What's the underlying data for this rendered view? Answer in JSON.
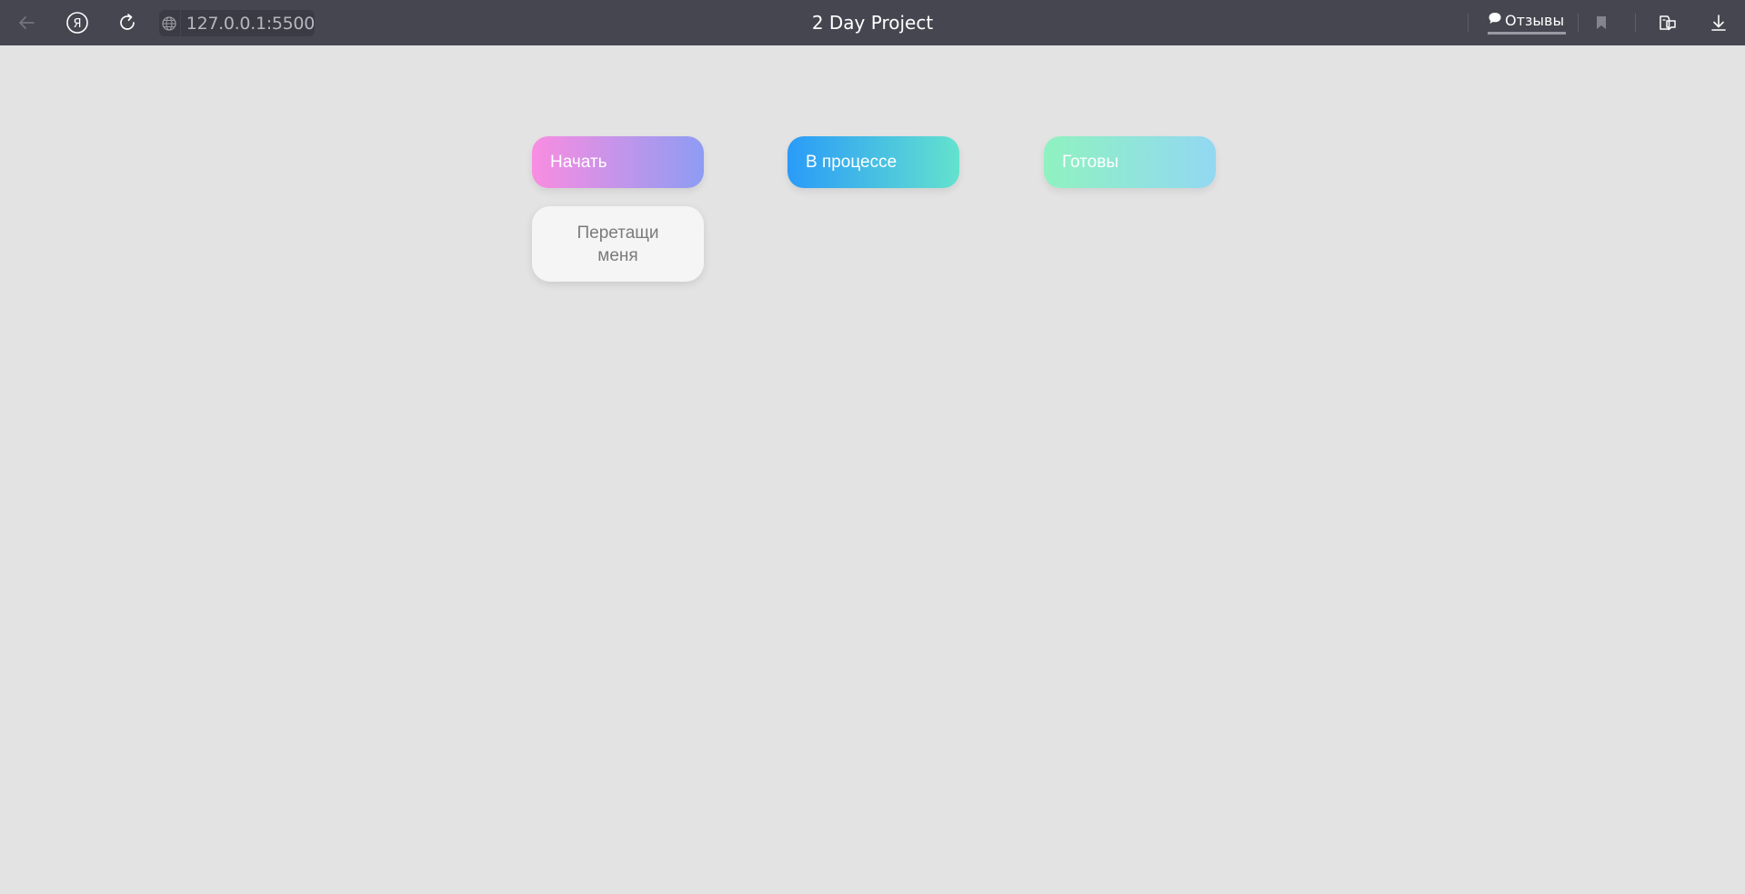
{
  "browser": {
    "url": "127.0.0.1:5500",
    "tab_title": "2 Day Project",
    "feedback_label": "Отзывы",
    "icons": [
      "back-icon",
      "yandex-icon",
      "reload-icon",
      "globe-icon",
      "comment-icon",
      "bookmark-icon",
      "reader-icon",
      "download-icon"
    ]
  },
  "board": {
    "columns": [
      {
        "label": "Начать",
        "gradient": [
          "#f98de1",
          "#8e9cf3"
        ]
      },
      {
        "label": "В процессе",
        "gradient": [
          "#2a9bf8",
          "#63e2ce"
        ]
      },
      {
        "label": "Готовы",
        "gradient": [
          "#8ff2c0",
          "#92d8f2"
        ]
      }
    ],
    "card": {
      "text": "Перетащи меня"
    }
  },
  "colors": {
    "titlebar": "#464650",
    "page_background": "#e3e3e3",
    "card_background": "#f5f5f5"
  }
}
